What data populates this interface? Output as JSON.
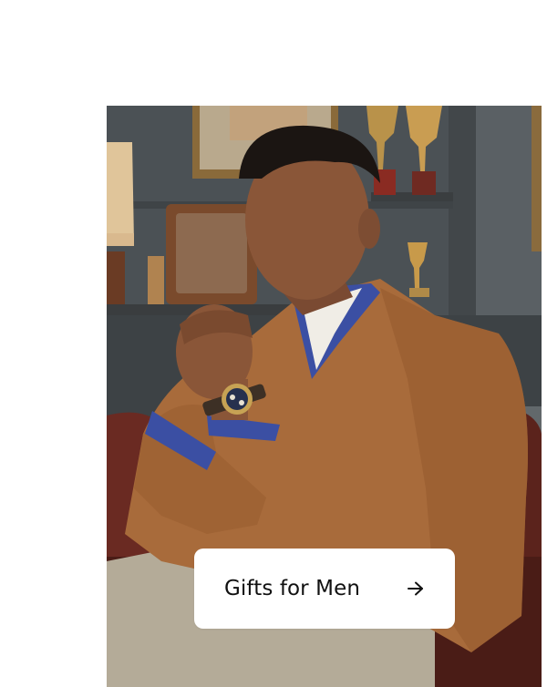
{
  "hero": {
    "image_description_icon": "man-wearing-watch-photo"
  },
  "cta": {
    "label": "Gifts for Men",
    "icon": "arrow-right-icon"
  },
  "colors": {
    "background": "#ffffff",
    "cta_background": "#ffffff",
    "cta_text": "#111111",
    "jacket": "#a86b3b",
    "wall": "#4b5155"
  }
}
